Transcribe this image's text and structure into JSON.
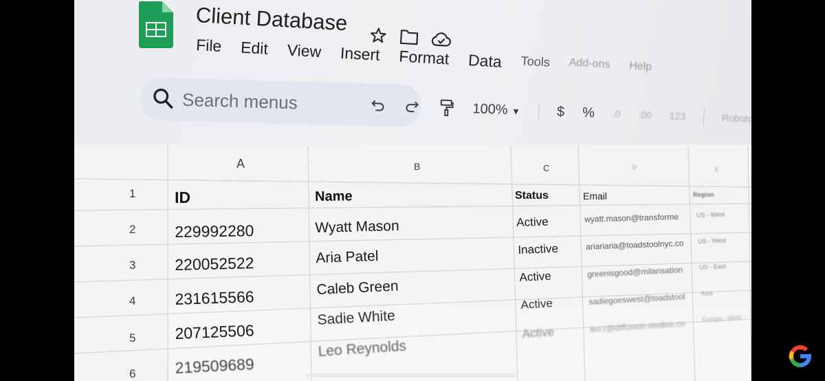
{
  "doc": {
    "title": "Client Database"
  },
  "menus": [
    "File",
    "Edit",
    "View",
    "Insert",
    "Format",
    "Data",
    "Tools",
    "Add-ons",
    "Help"
  ],
  "search": {
    "placeholder": "Search menus"
  },
  "toolbar": {
    "zoom": "100%",
    "currency": "$",
    "percent": "%",
    "font": "Roboto"
  },
  "columns": [
    "A",
    "B",
    "C",
    "D",
    "E"
  ],
  "headers": {
    "row": "1",
    "id": "ID",
    "name": "Name",
    "status": "Status",
    "email": "Email",
    "region": "Region"
  },
  "rows": [
    {
      "n": "2",
      "id": "229992280",
      "name": "Wyatt Mason",
      "status": "Active",
      "email": "wyatt.mason@transforme",
      "region": "US - West"
    },
    {
      "n": "3",
      "id": "220052522",
      "name": "Aria Patel",
      "status": "Inactive",
      "email": "ariariaria@toadstoolnyc.co",
      "region": "US - West"
    },
    {
      "n": "4",
      "id": "231615566",
      "name": "Caleb Green",
      "status": "Active",
      "email": "greenisgood@milansation",
      "region": "US - East"
    },
    {
      "n": "5",
      "id": "207125506",
      "name": "Sadie White",
      "status": "Active",
      "email": "sadiegoeswest@toadstool",
      "region": "Asia"
    },
    {
      "n": "6",
      "id": "219509689",
      "name": "Leo Reynolds",
      "status": "Active",
      "email": "leo.r@diffusion-studios.co",
      "region": "Europe - West"
    }
  ],
  "colors": {
    "sheets_green": "#0f9d58",
    "accent_blue": "#4285f4"
  }
}
